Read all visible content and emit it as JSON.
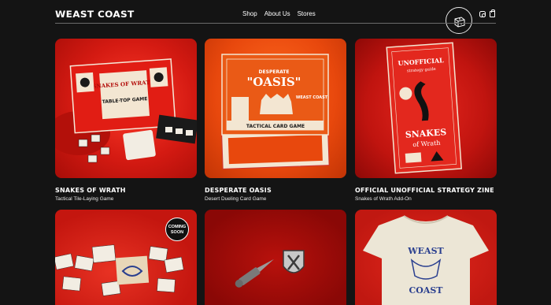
{
  "brand": {
    "logo": "WEAST COAST"
  },
  "nav": [
    {
      "label": "Shop"
    },
    {
      "label": "About Us"
    },
    {
      "label": "Stores"
    }
  ],
  "icons": {
    "badge": "dice-icon",
    "social": "instagram-icon",
    "cart": "shopping-bag-icon"
  },
  "products": [
    {
      "title": "SNAKES OF WRATH",
      "subtitle": "Tactical Tile-Laying Game",
      "image": "snakes-of-wrath-box"
    },
    {
      "title": "DESPERATE OASIS",
      "subtitle": "Desert Dueling Card Game",
      "image": "desperate-oasis-box"
    },
    {
      "title": "OFFICIAL UNOFFICIAL STRATEGY ZINE",
      "subtitle": "Snakes of Wrath Add-On",
      "image": "strategy-zine"
    },
    {
      "title": "",
      "subtitle": "",
      "image": "tiles-coming-soon",
      "badge": "COMING SOON"
    },
    {
      "title": "",
      "subtitle": "",
      "image": "enamel-pins"
    },
    {
      "title": "",
      "subtitle": "",
      "image": "weast-coast-tshirt",
      "shirt_text_top": "WEAST",
      "shirt_text_bottom": "COAST"
    }
  ],
  "art": {
    "p1_box": "SNAKES OF WRATH",
    "p1_box_sub": "TABLE-TOP GAME",
    "p2_big": "\"OASIS\"",
    "p2_top": "DESPERATE",
    "p2_bottom": "TACTICAL CARD GAME",
    "p2_corner": "WEAST COAST",
    "p3_head": "UNOFFICIAL",
    "p3_sub": "strategy guide",
    "p3_title": "SNAKES",
    "p3_title2": "of Wrath"
  },
  "colors": {
    "background": "#141414",
    "accent_red": "#d41a12",
    "accent_orange": "#e8480d"
  }
}
